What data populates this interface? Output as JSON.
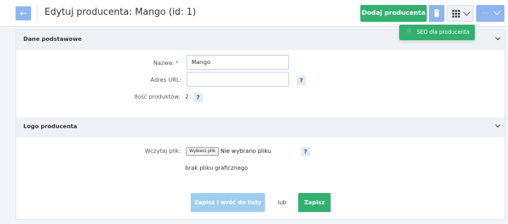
{
  "header": {
    "back_icon": "arrow-left-icon",
    "title": "Edytuj producenta: Mango (id: 1)",
    "add_button": "Dodaj producenta",
    "delete_icon": "trash-icon",
    "grid_icon": "grid-icon",
    "more_label": "...",
    "colors": {
      "primary": "#33b06f",
      "secondary": "#8fb5ee"
    }
  },
  "dropdown": {
    "icon": "star-icon",
    "item": "SEO dla producenta"
  },
  "sections": {
    "basic": {
      "title": "Dane podstawowe"
    },
    "logo": {
      "title": "Logo producenta"
    }
  },
  "form": {
    "name_label": "Nazwa:",
    "name_required": "*",
    "name_value": "Mango",
    "url_label": "Adres URL:",
    "url_value": "",
    "count_label": "Ilość produktów:",
    "count_value": "2",
    "help": "?",
    "file_label": "Wczytaj plik:",
    "file_button": "Wybierz plik",
    "file_status": "Nie wybrano pliku",
    "no_image": "brak pliku graficznego"
  },
  "actions": {
    "save_back": "Zapisz i wróć do listy",
    "or": "lub",
    "save": "Zapisz"
  }
}
